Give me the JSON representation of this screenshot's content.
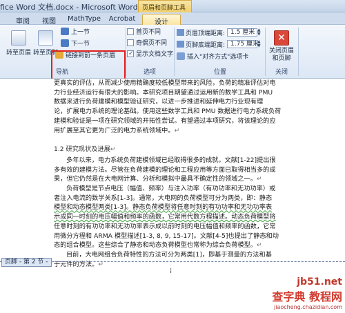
{
  "window": {
    "title": "fice Word 文档.docx - Microsoft Word",
    "context_tab_group": "页眉和页脚工具"
  },
  "tabs": [
    {
      "label": "审阅"
    },
    {
      "label": "视图"
    },
    {
      "label": "MathType"
    },
    {
      "label": "Acrobat"
    },
    {
      "label": "设计"
    }
  ],
  "ribbon": {
    "goto_header": "转至页眉",
    "goto_footer": "转至页脚",
    "prev_section": "上一节",
    "next_section": "下一节",
    "link_to_previous": "链接到前一条页眉",
    "different_first_page": "首页不同",
    "different_odd_even": "奇偶页不同",
    "show_document_text": "显示文档文字",
    "header_top_label": "页眉顶端距离:",
    "header_top_value": "1.5 厘米",
    "footer_bottom_label": "页脚底端距离:",
    "footer_bottom_value": "1.75 厘米",
    "insert_align_tab": "插入\"对齐方式\"选项卡",
    "close_button": "关闭页眉和页脚",
    "groups": {
      "navigation": "导航",
      "options": "选项",
      "position": "位置",
      "close": "关闭"
    }
  },
  "document": {
    "p1_line1": "更真实的评估，从而减少使用精确度较低模型带来的风险，负荷的精准评估对电",
    "p1_line2": "力行业经济运行有很大的影响。本研究项目期望通过运用新的数学工具和 PMU",
    "p1_line3": "数据来进行负荷建模和模型验证研究，以进一步推进和延伸电力行业现有理",
    "p1_line4": "论，扩展电力系统的理论基础。使用这些数学工具和 PMU 数据进行电力系统负荷",
    "p1_line5": "建模和验证是一项在研究领域的开拓性尝试。有望通过本项研究，将该理论的应",
    "p1_line6": "用扩展至其它更为广泛的电力系统领域中。",
    "heading": "1.2 研究现状及进展",
    "p2_line1": "多年以来，电力系统负荷建模领域已经取得很多的成就。文献[1-22]提出很",
    "p2_line2": "多有效的建模方法。尽管在负荷建模的理论和工程应用等方面已取得相当多的成",
    "p2_line3": "果，但它仍然是在大电网计算、分析和模拟中最具不确定性的领域之一。",
    "p3_line1": "负荷模型是节点电压（幅值、频率）与注入功率（有功功率和无功功率）或",
    "p3_line2": "者注入电流的数学关系[1-3]。通常，大电网的负荷模型可分为两类，即：静态",
    "p3_line3": "模型和动态模型两类[1-3]。静态负荷模型将任意时刻的有功功率和无功功率表",
    "p3_line4": "示成同一时刻的电压幅值和频率的函数，它常用代数方程描述。动态负荷模型将",
    "p3_line5": "任意时刻的有功功率和无功功率表示成以前时刻的电压幅值和频率的函数，它常",
    "p3_line6": "用微分方程和 ARMA 模型描述[1-3, 8, 9, 15-17]。文献[4-5]也提出了静态和动",
    "p3_line7": "态的组合模型。这些综合了静态和动态负荷模型也常称为综合负荷模型。",
    "p4_line1": "目前，大电网组合负荷特性的方法可分为两类[1]，即基于测量的方法和基",
    "p4_line2": "于元件的方法。",
    "paragraph_mark": "↵",
    "footer_label": "页脚 - 第 2 节 -"
  },
  "watermark": {
    "site": "jb51.net",
    "name": "查字典 教程网",
    "url": "jiaocheng.chazidian.com"
  },
  "colors": {
    "ribbon_bg": "#dce7f5",
    "active_tab": "#fbe5a2",
    "highlight_box": "#e02020",
    "watermark": "#d23b2e"
  }
}
